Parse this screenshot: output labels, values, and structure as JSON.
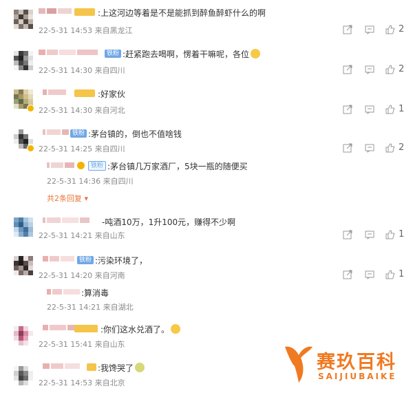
{
  "comments": [
    {
      "text": ":上这河边等着是不是能抓到醉鱼醉虾什么的啊",
      "badge": "",
      "time": "22-5-31 14:53",
      "location": "来自黑龙江",
      "likes": "2"
    },
    {
      "text": ":赶紧跑去喝啊，愣着干嘛呢，各位",
      "badge": "铁粉",
      "time": "22-5-31 14:30",
      "location": "来自四川",
      "likes": "2"
    },
    {
      "text": ":好家伙",
      "badge": "",
      "time": "22-5-31 14:30",
      "location": "来自河北",
      "likes": "1"
    },
    {
      "text": ":茅台镇的，倒也不值啥钱",
      "badge": "铁粉",
      "time": "22-5-31 14:25",
      "location": "来自四川",
      "likes": "2"
    },
    {
      "text": "-吨酒10万，1升100元，赚得不少啊",
      "badge": "",
      "time": "22-5-31 14:21",
      "location": "来自山东",
      "likes": "1"
    },
    {
      "text": ":污染环境了，",
      "badge": "铁粉",
      "time": "22-5-31 14:20",
      "location": "来自河南",
      "likes": "1"
    },
    {
      "text": ":你们这水兑酒了。",
      "badge": "",
      "time": "22-5-31 15:41",
      "location": "来自山东",
      "likes": ""
    },
    {
      "text": ":我馋哭了",
      "badge": "",
      "time": "22-5-31 14:53",
      "location": "来自北京",
      "likes": ""
    }
  ],
  "replies": [
    {
      "text": ":茅台镇几万家酒厂，5块一瓶的随便买",
      "badge": "铁粉",
      "time": "22-5-31 14:36",
      "location": "来自四川"
    },
    {
      "text": ":算消毒",
      "badge": "",
      "time": "22-5-31 14:21",
      "location": "来自湖北"
    }
  ],
  "more_replies": "共2条回复",
  "logo": {
    "cn": "赛玖百科",
    "en": "SAIJIUBAIKE"
  },
  "colors": {
    "accent": "#6fa7e6",
    "more": "#e8763a",
    "logo_orange": "#f07a22"
  }
}
